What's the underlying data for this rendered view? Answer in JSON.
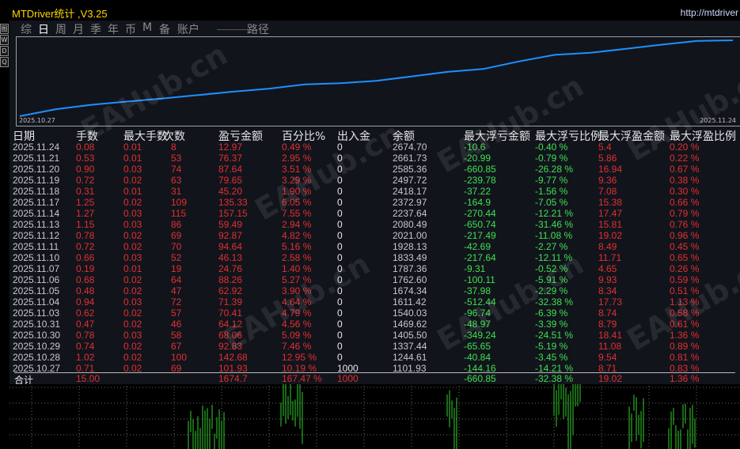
{
  "window": {
    "title": "MTDriver统计  ,V3.25",
    "url": "http://mtdriver"
  },
  "left_buttons": [
    "图",
    "W",
    "D",
    "Q"
  ],
  "tabs": [
    {
      "label": "综",
      "active": false
    },
    {
      "label": "日",
      "active": true
    },
    {
      "label": "周",
      "active": false
    },
    {
      "label": "月",
      "active": false
    },
    {
      "label": "季",
      "active": false
    },
    {
      "label": "年",
      "active": false
    },
    {
      "label": "币",
      "active": false
    },
    {
      "label": "M",
      "active": false
    },
    {
      "label": "备",
      "active": false
    },
    {
      "label": "账户",
      "active": false
    },
    {
      "label": "路径",
      "active": false
    }
  ],
  "equity_chart": {
    "start_label": "2025.10.27",
    "end_label": "2025.11.24",
    "line_color": "#1e90ff",
    "values": [
      1101.93,
      1244.61,
      1337.44,
      1405.5,
      1469.62,
      1540.03,
      1611.42,
      1674.34,
      1762.6,
      1787.36,
      1833.49,
      1928.13,
      2021.0,
      2080.49,
      2237.64,
      2372.97,
      2418.17,
      2497.72,
      2585.36,
      2661.73,
      2674.7
    ]
  },
  "headers": [
    "日期",
    "手数",
    "最大手数",
    "次数",
    "盈亏金额",
    "百分比%",
    "出入金",
    "余额",
    "最大浮亏金额",
    "最大浮亏比例",
    "最大浮盈金额",
    "最大浮盈比例"
  ],
  "rows": [
    [
      "2025.11.24",
      "0.08",
      "0.01",
      "8",
      "12.97",
      "0.49 %",
      "0",
      "2674.70",
      "-10.6",
      "-0.40 %",
      "5.4",
      "0.20 %"
    ],
    [
      "2025.11.21",
      "0.53",
      "0.01",
      "53",
      "76.37",
      "2.95 %",
      "0",
      "2661.73",
      "-20.99",
      "-0.79 %",
      "5.86",
      "0.22 %"
    ],
    [
      "2025.11.20",
      "0.90",
      "0.03",
      "74",
      "87.64",
      "3.51 %",
      "0",
      "2585.36",
      "-660.85",
      "-26.28 %",
      "16.94",
      "0.67 %"
    ],
    [
      "2025.11.19",
      "0.72",
      "0.02",
      "63",
      "79.65",
      "3.29 %",
      "0",
      "2497.72",
      "-239.78",
      "-9.77 %",
      "9.36",
      "0.38 %"
    ],
    [
      "2025.11.18",
      "0.31",
      "0.01",
      "31",
      "45.20",
      "1.90 %",
      "0",
      "2418.17",
      "-37.22",
      "-1.56 %",
      "7.08",
      "0.30 %"
    ],
    [
      "2025.11.17",
      "1.25",
      "0.02",
      "109",
      "135.33",
      "6.05 %",
      "0",
      "2372.97",
      "-164.9",
      "-7.05 %",
      "15.38",
      "0.66 %"
    ],
    [
      "2025.11.14",
      "1.27",
      "0.03",
      "115",
      "157.15",
      "7.55 %",
      "0",
      "2237.64",
      "-270.44",
      "-12.21 %",
      "17.47",
      "0.79 %"
    ],
    [
      "2025.11.13",
      "1.15",
      "0.03",
      "86",
      "59.49",
      "2.94 %",
      "0",
      "2080.49",
      "-650.74",
      "-31.46 %",
      "15.81",
      "0.76 %"
    ],
    [
      "2025.11.12",
      "0.78",
      "0.02",
      "69",
      "92.87",
      "4.82 %",
      "0",
      "2021.00",
      "-217.49",
      "-11.08 %",
      "19.02",
      "0.96 %"
    ],
    [
      "2025.11.11",
      "0.72",
      "0.02",
      "70",
      "94.64",
      "5.16 %",
      "0",
      "1928.13",
      "-42.69",
      "-2.27 %",
      "8.49",
      "0.45 %"
    ],
    [
      "2025.11.10",
      "0.66",
      "0.03",
      "52",
      "46.13",
      "2.58 %",
      "0",
      "1833.49",
      "-217.64",
      "-12.11 %",
      "11.71",
      "0.65 %"
    ],
    [
      "2025.11.07",
      "0.19",
      "0.01",
      "19",
      "24.76",
      "1.40 %",
      "0",
      "1787.36",
      "-9.31",
      "-0.52 %",
      "4.65",
      "0.26 %"
    ],
    [
      "2025.11.06",
      "0.68",
      "0.02",
      "64",
      "88.26",
      "5.27 %",
      "0",
      "1762.60",
      "-100.11",
      "-5.91 %",
      "9.93",
      "0.59 %"
    ],
    [
      "2025.11.05",
      "0.48",
      "0.02",
      "47",
      "62.92",
      "3.90 %",
      "0",
      "1674.34",
      "-37.98",
      "-2.29 %",
      "8.34",
      "0.51 %"
    ],
    [
      "2025.11.04",
      "0.94",
      "0.03",
      "72",
      "71.39",
      "4.64 %",
      "0",
      "1611.42",
      "-512.44",
      "-32.38 %",
      "17.73",
      "1.13 %"
    ],
    [
      "2025.11.03",
      "0.62",
      "0.02",
      "57",
      "70.41",
      "4.79 %",
      "0",
      "1540.03",
      "-96.74",
      "-6.39 %",
      "8.74",
      "0.58 %"
    ],
    [
      "2025.10.31",
      "0.47",
      "0.02",
      "46",
      "64.12",
      "4.56 %",
      "0",
      "1469.62",
      "-48.97",
      "-3.39 %",
      "8.79",
      "0.61 %"
    ],
    [
      "2025.10.30",
      "0.78",
      "0.03",
      "58",
      "68.06",
      "5.09 %",
      "0",
      "1405.50",
      "-349.24",
      "-24.51 %",
      "18.41",
      "1.36 %"
    ],
    [
      "2025.10.29",
      "0.74",
      "0.02",
      "67",
      "92.83",
      "7.46 %",
      "0",
      "1337.44",
      "-65.65",
      "-5.19 %",
      "11.08",
      "0.89 %"
    ],
    [
      "2025.10.28",
      "1.02",
      "0.02",
      "100",
      "142.68",
      "12.95 %",
      "0",
      "1244.61",
      "-40.84",
      "-3.45 %",
      "9.54",
      "0.81 %"
    ],
    [
      "2025.10.27",
      "0.71",
      "0.02",
      "69",
      "101.93",
      "10.19 %",
      "1000",
      "1101.93",
      "-144.16",
      "-14.21 %",
      "8.71",
      "0.83 %"
    ]
  ],
  "total": [
    "合计",
    "15.00",
    "",
    "",
    "1674.7",
    "167.47 %",
    "1000",
    "",
    "-660.85",
    "-32.38 %",
    "19.02",
    "1.36 %"
  ],
  "watermark": "EAHub.cn",
  "colors": {
    "profit": "#e03030",
    "loss": "#3ee04f",
    "accent": "#ffd700"
  }
}
